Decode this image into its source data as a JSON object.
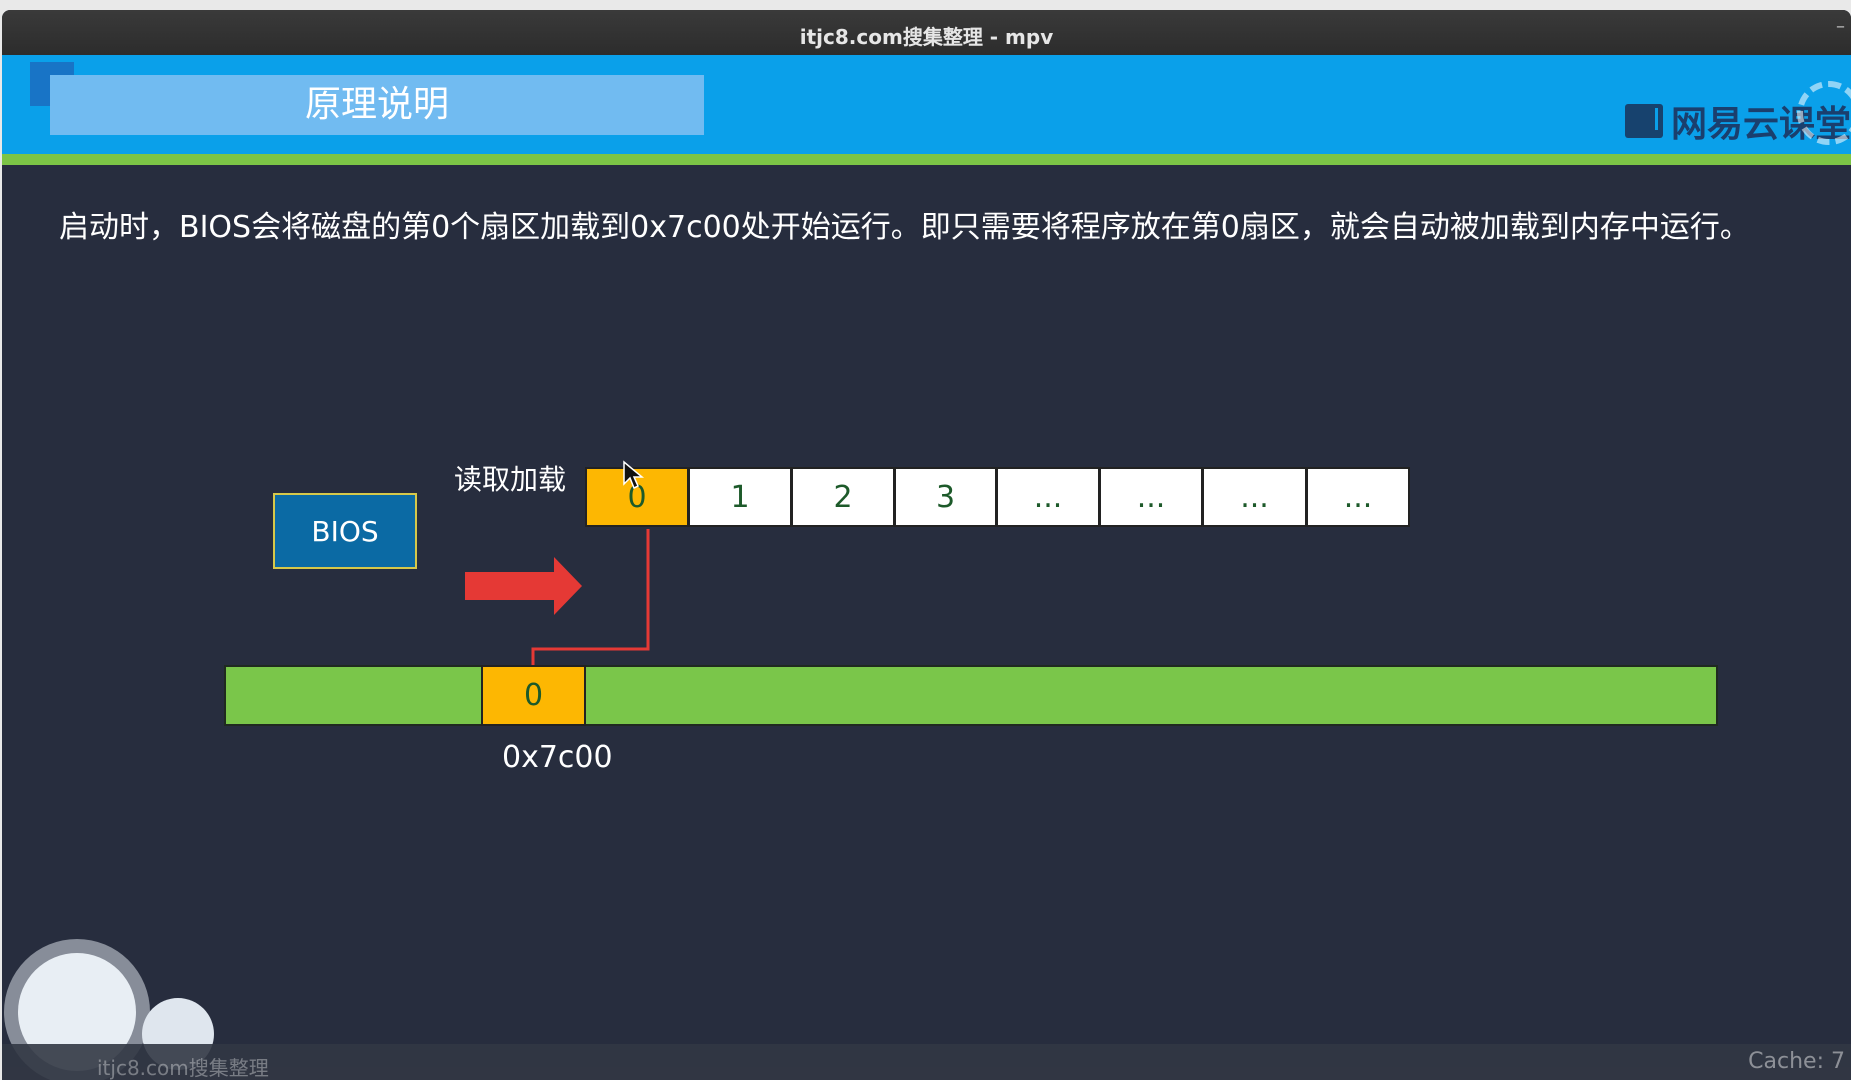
{
  "window": {
    "title": "itjc8.com搜集整理 - mpv",
    "min_label": "–"
  },
  "slide": {
    "heading": "原理说明",
    "logo_text": "网易云课堂",
    "description": "启动时，BIOS会将磁盘的第0个扇区加载到0x7c00处开始运行。即只需要将程序放在第0扇区，就会自动被加载到内存中运行。",
    "disk_cells": [
      "0",
      "1",
      "2",
      "3",
      "...",
      "...",
      "...",
      "..."
    ],
    "bios_label": "BIOS",
    "read_label": "读取加载",
    "memory_cell": "0",
    "memory_address": "0x7c00"
  },
  "overlay": {
    "watermark": "itjc8.com搜集整理",
    "cache": "Cache: 7"
  },
  "colors": {
    "header_blue": "#0aa0ea",
    "accent_green": "#7cc446",
    "orange": "#fdb702",
    "bios_blue": "#0b6aa4",
    "arrow_red": "#e53935",
    "slide_bg": "#272d3e"
  }
}
